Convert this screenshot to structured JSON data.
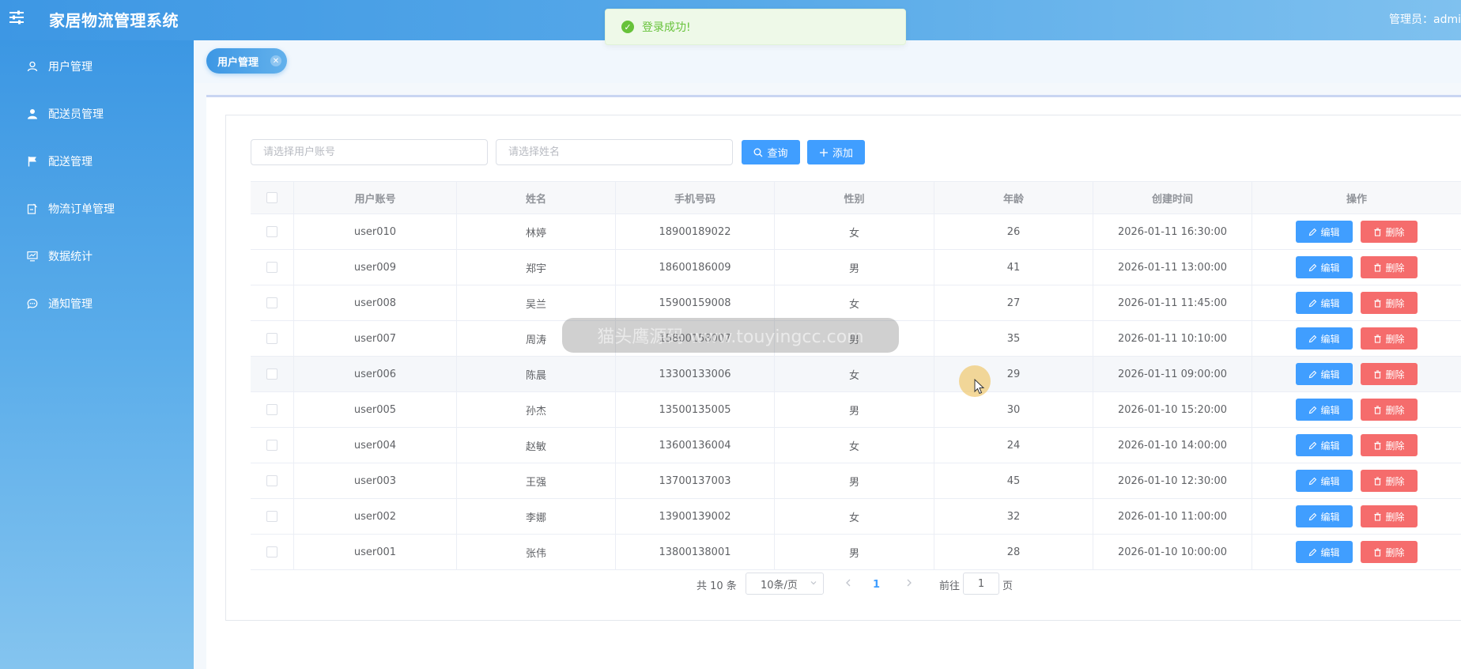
{
  "header": {
    "app_title": "家居物流管理系统",
    "admin_label": "管理员：admi",
    "menu_icon": "sliders-icon"
  },
  "toast": {
    "message": "登录成功!",
    "icon": "success-check-icon"
  },
  "sidebar": {
    "items": [
      {
        "label": "用户管理",
        "icon": "user-icon"
      },
      {
        "label": "配送员管理",
        "icon": "person-filled-icon"
      },
      {
        "label": "配送管理",
        "icon": "flag-icon"
      },
      {
        "label": "物流订单管理",
        "icon": "document-icon"
      },
      {
        "label": "数据统计",
        "icon": "chart-monitor-icon"
      },
      {
        "label": "通知管理",
        "icon": "chat-bubble-icon"
      }
    ]
  },
  "tabs": [
    {
      "label": "用户管理",
      "active": true
    }
  ],
  "search": {
    "account_placeholder": "请选择用户账号",
    "name_placeholder": "请选择姓名",
    "query_label": "查询",
    "add_label": "添加"
  },
  "table": {
    "columns": [
      "用户账号",
      "姓名",
      "手机号码",
      "性别",
      "年龄",
      "创建时间",
      "操作"
    ],
    "edit_label": "编辑",
    "delete_label": "删除",
    "rows": [
      {
        "account": "user010",
        "name": "林婷",
        "phone": "18900189022",
        "gender": "女",
        "age": "26",
        "created": "2026-01-11 16:30:00"
      },
      {
        "account": "user009",
        "name": "郑宇",
        "phone": "18600186009",
        "gender": "男",
        "age": "41",
        "created": "2026-01-11 13:00:00"
      },
      {
        "account": "user008",
        "name": "吴兰",
        "phone": "15900159008",
        "gender": "女",
        "age": "27",
        "created": "2026-01-11 11:45:00"
      },
      {
        "account": "user007",
        "name": "周涛",
        "phone": "15800158007",
        "gender": "男",
        "age": "35",
        "created": "2026-01-11 10:10:00"
      },
      {
        "account": "user006",
        "name": "陈晨",
        "phone": "13300133006",
        "gender": "女",
        "age": "29",
        "created": "2026-01-11 09:00:00"
      },
      {
        "account": "user005",
        "name": "孙杰",
        "phone": "13500135005",
        "gender": "男",
        "age": "30",
        "created": "2026-01-10 15:20:00"
      },
      {
        "account": "user004",
        "name": "赵敏",
        "phone": "13600136004",
        "gender": "女",
        "age": "24",
        "created": "2026-01-10 14:00:00"
      },
      {
        "account": "user003",
        "name": "王强",
        "phone": "13700137003",
        "gender": "男",
        "age": "45",
        "created": "2026-01-10 12:30:00"
      },
      {
        "account": "user002",
        "name": "李娜",
        "phone": "13900139002",
        "gender": "女",
        "age": "32",
        "created": "2026-01-10 11:00:00"
      },
      {
        "account": "user001",
        "name": "张伟",
        "phone": "13800138001",
        "gender": "男",
        "age": "28",
        "created": "2026-01-10 10:00:00"
      }
    ]
  },
  "pagination": {
    "total": "共 10 条",
    "page_size": "10条/页",
    "current_page": "1",
    "goto_prefix": "前往",
    "goto_value": "1",
    "goto_suffix": "页"
  },
  "watermark": {
    "text": "猫头鹰源码 www.touyingcc.com"
  },
  "colors": {
    "primary": "#409eff",
    "danger": "#f56c6c",
    "success": "#67c23a",
    "brand": "#3d97e4"
  }
}
